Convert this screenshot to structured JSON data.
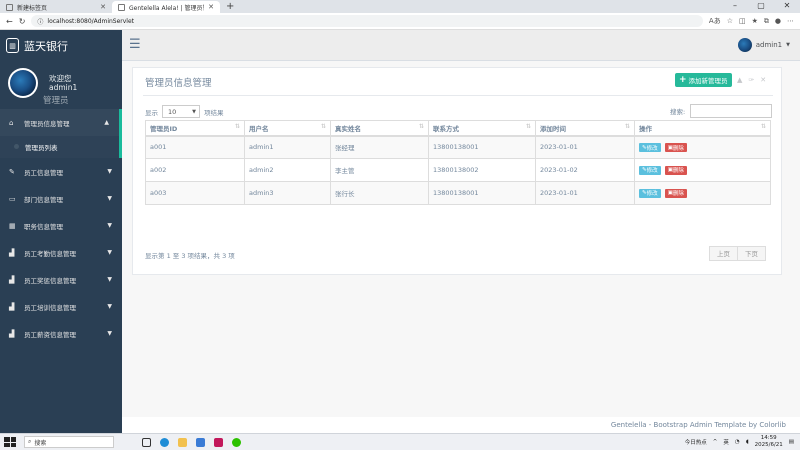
{
  "browser": {
    "tabs": [
      {
        "title": "新建标签页"
      },
      {
        "title": "Gentelella Alela! | 管理员管理"
      }
    ],
    "url": "localhost:8080/AdminServlet"
  },
  "sidebar": {
    "brand": "蓝天银行",
    "welcome": "欢迎您",
    "username": "admin1",
    "role": "管理员",
    "menu": [
      {
        "label": "管理员信息管理",
        "icon": "home-icon"
      },
      {
        "label": "员工信息管理",
        "icon": "edit-icon"
      },
      {
        "label": "部门信息管理",
        "icon": "desktop-icon"
      },
      {
        "label": "职务信息管理",
        "icon": "table-icon"
      },
      {
        "label": "员工考勤信息管理",
        "icon": "bar-chart-icon"
      },
      {
        "label": "员工奖惩信息管理",
        "icon": "bar-chart-icon"
      },
      {
        "label": "员工培训信息管理",
        "icon": "bar-chart-icon"
      },
      {
        "label": "员工薪资信息管理",
        "icon": "bar-chart-icon"
      }
    ],
    "submenu": [
      {
        "label": "管理员列表"
      }
    ]
  },
  "topnav": {
    "user": "admin1"
  },
  "panel": {
    "title": "管理员信息管理",
    "add_button": "添加新管理员",
    "length_prefix": "显示",
    "length_value": "10",
    "length_suffix": "项结果",
    "search_label": "搜索:",
    "columns": [
      "管理员ID",
      "用户名",
      "真实姓名",
      "联系方式",
      "添加时间",
      "操作"
    ],
    "rows": [
      {
        "id": "a001",
        "username": "admin1",
        "realname": "张经理",
        "phone": "13800138001",
        "date": "2023-01-01"
      },
      {
        "id": "a002",
        "username": "admin2",
        "realname": "李主管",
        "phone": "13800138002",
        "date": "2023-01-02"
      },
      {
        "id": "a003",
        "username": "admin3",
        "realname": "张行长",
        "phone": "13800138001",
        "date": "2023-01-01"
      }
    ],
    "edit_label": "修改",
    "delete_label": "删除",
    "info": "显示第 1 至 3 项结果，共 3 项",
    "prev": "上页",
    "next": "下页"
  },
  "footer": "Gentelella - Bootstrap Admin Template by Colorlib",
  "taskbar": {
    "search_placeholder": "搜索",
    "weather": "今日热点",
    "time": "14:59",
    "date": "2025/6/21"
  },
  "colors": {
    "sidebar_bg": "#2A3F54",
    "accent": "#1ABB9C",
    "add_button": "#26B99A",
    "edit_button": "#5BC0DE",
    "delete_button": "#D9534F"
  }
}
